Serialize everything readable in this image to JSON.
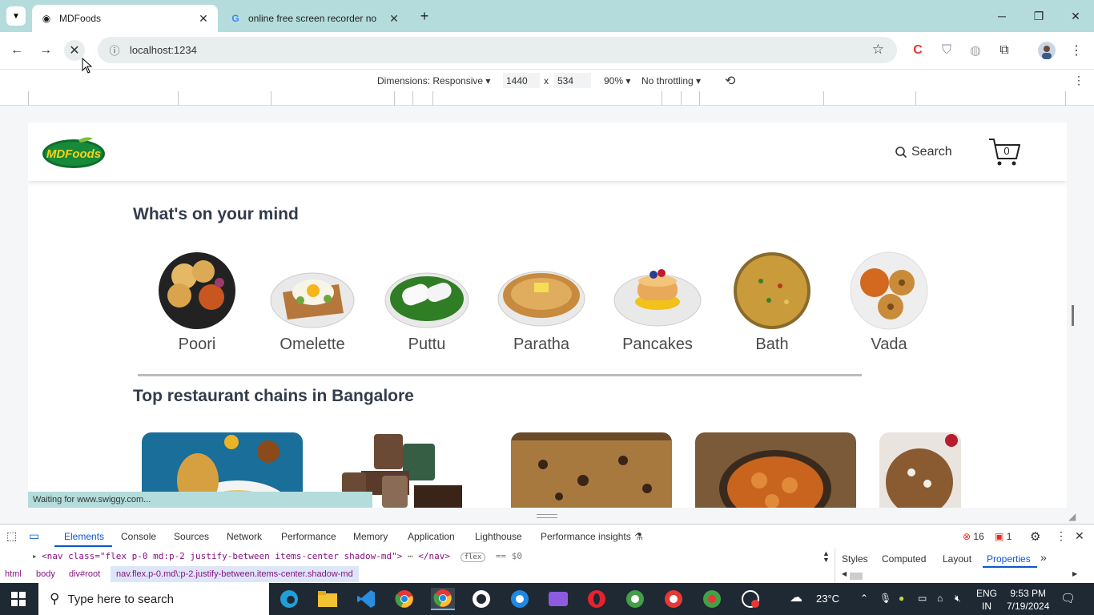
{
  "browser": {
    "tabs": [
      {
        "title": "MDFoods",
        "active": true
      },
      {
        "title": "online free screen recorder no",
        "active": false
      }
    ],
    "new_tab_icon": "plus-icon",
    "url": "localhost:1234"
  },
  "device_toolbar": {
    "dimensions": "Dimensions: Responsive",
    "width": "1440",
    "x": "x",
    "height": "534",
    "zoom": "90%",
    "throttling": "No throttling"
  },
  "site": {
    "logo_text": "MDFoods",
    "search_label": "Search",
    "cart_count": "0",
    "mind_title": "What's on your mind",
    "foods": [
      {
        "label": "Poori"
      },
      {
        "label": "Omelette"
      },
      {
        "label": "Puttu"
      },
      {
        "label": "Paratha"
      },
      {
        "label": "Pancakes"
      },
      {
        "label": "Bath"
      },
      {
        "label": "Vada"
      }
    ],
    "chains_title": "Top restaurant chains in Bangalore"
  },
  "status_text": "Waiting for www.swiggy.com...",
  "devtools": {
    "tabs": [
      "Elements",
      "Console",
      "Sources",
      "Network",
      "Performance",
      "Memory",
      "Application",
      "Lighthouse",
      "Performance insights"
    ],
    "errors": "16",
    "issues": "1",
    "dom_line": "<nav class=\"flex p-0 md:p-2 justify-between items-center shadow-md\">",
    "dom_ellipsis": "⋯",
    "dom_close": "</nav>",
    "dom_badge": "flex",
    "dom_eq": "== $0",
    "breadcrumbs": [
      "html",
      "body",
      "div#root",
      "nav.flex.p-0.md\\:p-2.justify-between.items-center.shadow-md"
    ],
    "side_tabs": [
      "Styles",
      "Computed",
      "Layout",
      "Properties"
    ]
  },
  "taskbar": {
    "search_placeholder": "Type here to search",
    "weather": "23°C",
    "lang_top": "ENG",
    "lang_bottom": "IN",
    "time": "9:53 PM",
    "date": "7/19/2024"
  }
}
